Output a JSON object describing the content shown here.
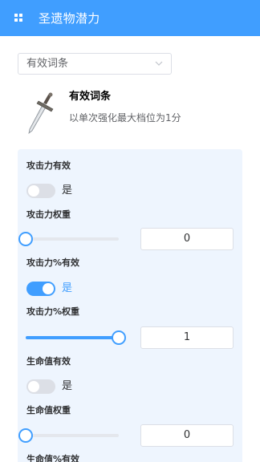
{
  "header": {
    "title": "圣遗物潜力",
    "menu_icon": "grid-menu-icon",
    "background": "#409eff"
  },
  "select": {
    "value": "有效词条",
    "arrow_icon": "chevron-down-icon"
  },
  "item": {
    "name": "有效词条",
    "description": "以单次强化最大档位为1分",
    "image_icon": "sword-icon"
  },
  "accent": "#409eff",
  "settings": [
    {
      "valid_label": "攻击力有效",
      "switch_on": false,
      "switch_text": "是",
      "weight_label": "攻击力权重",
      "weight": "0",
      "slider_fraction": 0
    },
    {
      "valid_label": "攻击力%有效",
      "switch_on": true,
      "switch_text": "是",
      "weight_label": "攻击力%权重",
      "weight": "1",
      "slider_fraction": 1
    },
    {
      "valid_label": "生命值有效",
      "switch_on": false,
      "switch_text": "是",
      "weight_label": "生命值权重",
      "weight": "0",
      "slider_fraction": 0
    },
    {
      "valid_label": "生命值%有效"
    }
  ]
}
